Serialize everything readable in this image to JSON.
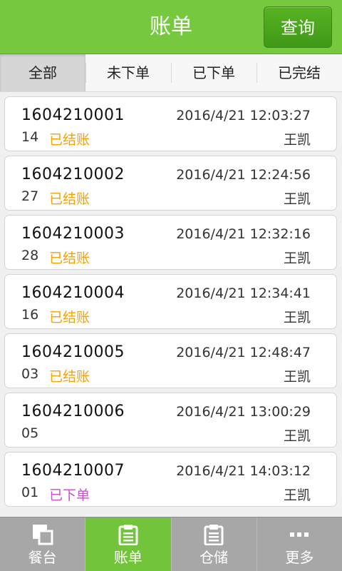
{
  "header": {
    "title": "账单",
    "query_label": "查询",
    "color": "#76c83e"
  },
  "tabs": [
    {
      "label": "全部",
      "active": true
    },
    {
      "label": "未下单",
      "active": false
    },
    {
      "label": "已下单",
      "active": false
    },
    {
      "label": "已完结",
      "active": false
    }
  ],
  "orders": [
    {
      "order_no": "1604210001",
      "time": "2016/4/21 12:03:27",
      "table": "14",
      "status": "已结账",
      "status_color": "#f5a200",
      "staff": "王凯"
    },
    {
      "order_no": "1604210002",
      "time": "2016/4/21 12:24:56",
      "table": "27",
      "status": "已结账",
      "status_color": "#f5a200",
      "staff": "王凯"
    },
    {
      "order_no": "1604210003",
      "time": "2016/4/21 12:32:16",
      "table": "28",
      "status": "已结账",
      "status_color": "#f5a200",
      "staff": "王凯"
    },
    {
      "order_no": "1604210004",
      "time": "2016/4/21 12:34:41",
      "table": "16",
      "status": "已结账",
      "status_color": "#f5a200",
      "staff": "王凯"
    },
    {
      "order_no": "1604210005",
      "time": "2016/4/21 12:48:47",
      "table": "03",
      "status": "已结账",
      "status_color": "#f5a200",
      "staff": "王凯"
    },
    {
      "order_no": "1604210006",
      "time": "2016/4/21 13:00:29",
      "table": "05",
      "status": "",
      "status_color": "#f5a200",
      "staff": "王凯"
    },
    {
      "order_no": "1604210007",
      "time": "2016/4/21 14:03:12",
      "table": "01",
      "status": "已下单",
      "status_color": "#c94ec9",
      "staff": "王凯"
    }
  ],
  "bottom_nav": [
    {
      "label": "餐台",
      "icon": "tables-icon",
      "active": false
    },
    {
      "label": "账单",
      "icon": "clipboard-icon",
      "active": true
    },
    {
      "label": "仓储",
      "icon": "clipboard-icon",
      "active": false
    },
    {
      "label": "更多",
      "icon": "more-icon",
      "active": false
    }
  ]
}
